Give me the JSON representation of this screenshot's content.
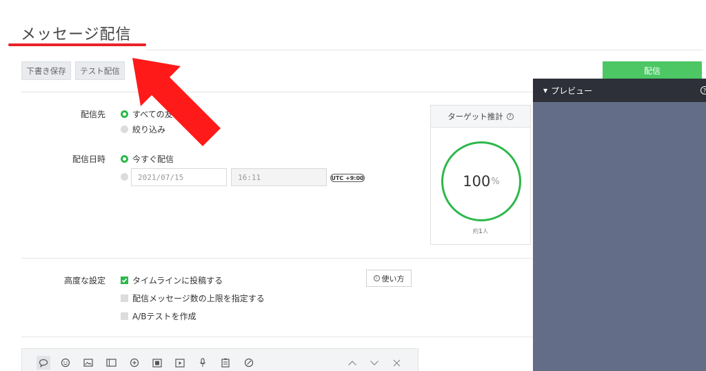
{
  "page": {
    "title": "メッセージ配信"
  },
  "actions": {
    "draft": "下書き保存",
    "test": "テスト配信",
    "send": "配信"
  },
  "recipients": {
    "label": "配信先",
    "all": "すべての友",
    "filter": "絞り込み"
  },
  "schedule": {
    "label": "配信日時",
    "now": "今すぐ配信",
    "date_placeholder": "2021/07/15",
    "time_placeholder": "16:11",
    "timezone": "UTC +9:00"
  },
  "target": {
    "title": "ターゲット推計",
    "help": "?",
    "percent": "100",
    "percent_unit": "%",
    "approx_prefix": "約",
    "count": "1",
    "count_unit": "人"
  },
  "advanced": {
    "label": "高度な設定",
    "timeline": {
      "label": "タイムラインに投稿する",
      "checked": true
    },
    "limit": {
      "label": "配信メッセージ数の上限を指定する",
      "checked": false
    },
    "abtest": {
      "label": "A/Bテストを作成",
      "checked": false
    },
    "howto": "使い方",
    "howto_icon": "i"
  },
  "toolbar": {
    "icons": [
      "speech-bubble-icon",
      "sticker-icon",
      "image-icon",
      "card-icon",
      "coupon-icon",
      "rich-message-icon",
      "video-icon",
      "microphone-icon",
      "survey-icon",
      "rich-video-icon",
      "chevron-up-icon",
      "chevron-down-icon",
      "close-icon"
    ]
  },
  "preview": {
    "title": "プレビュー",
    "help": "?"
  },
  "colors": {
    "accent": "#2db84b",
    "send_button": "#4cc764",
    "annotation_arrow": "#ff1a1a",
    "preview_bg": "#636d87",
    "preview_header": "#2d3038"
  }
}
